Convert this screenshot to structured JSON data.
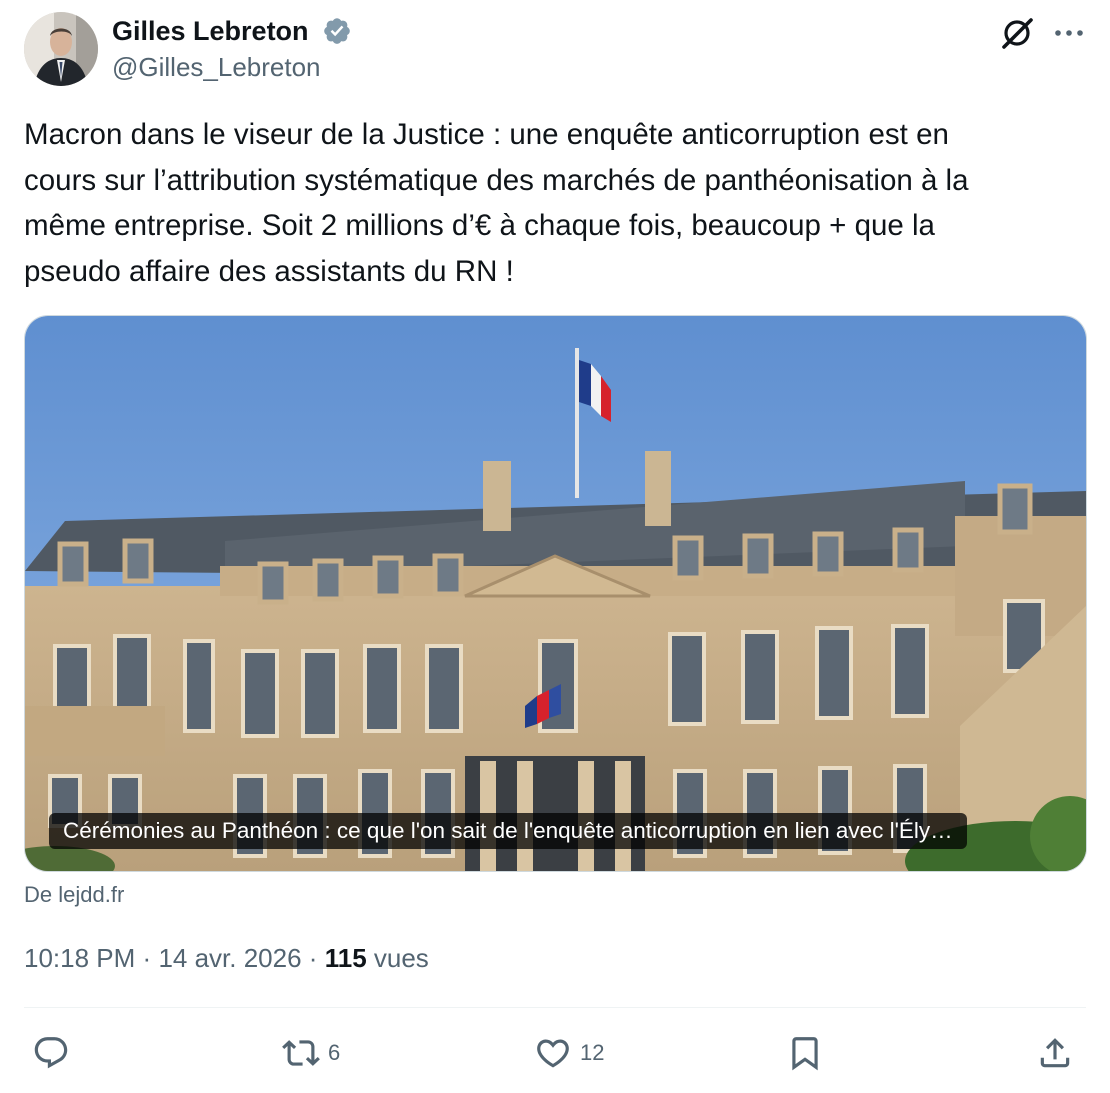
{
  "author": {
    "name": "Gilles Lebreton",
    "handle": "@Gilles_Lebreton",
    "verified": true
  },
  "header_icons": [
    "grok-icon",
    "more-icon"
  ],
  "tweet": {
    "text": "Macron dans le viseur de la Justice : une enquête anticorruption est en\ncours sur l’attribution systématique des marchés de panthéonisation à la\nmême entreprise. Soit 2 millions d’€ à chaque fois, beaucoup + que la\npseudo affaire des assistants du RN !"
  },
  "card": {
    "caption": "Cérémonies au Panthéon : ce que l'on sait de l'enquête anticorruption en lien avec l'Ély…",
    "source": "De lejdd.fr"
  },
  "meta": {
    "time": "10:18 PM",
    "separator": "·",
    "date": "14 avr. 2026",
    "views_count": "115",
    "views_label": "vues"
  },
  "actions": {
    "reply": {
      "icon": "reply-icon",
      "count": ""
    },
    "repost": {
      "icon": "repost-icon",
      "count": "6"
    },
    "like": {
      "icon": "heart-icon",
      "count": "12"
    },
    "bookmark": {
      "icon": "bookmark-icon",
      "count": ""
    },
    "share": {
      "icon": "share-icon",
      "count": ""
    }
  },
  "colors": {
    "text": "#0f1419",
    "secondary": "#536471",
    "verified_badge": "#829aab",
    "sky": "#6d9ad6"
  }
}
